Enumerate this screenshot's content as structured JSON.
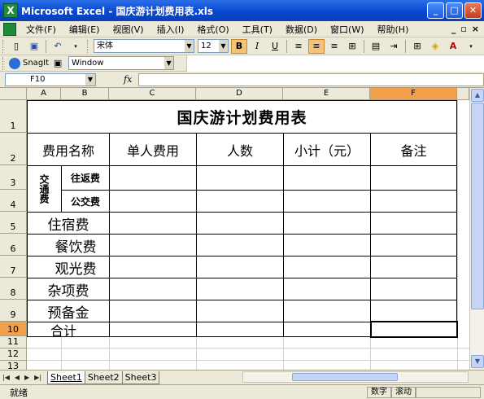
{
  "window": {
    "title": "Microsoft Excel - 国庆游计划费用表.xls",
    "app_icon": "X"
  },
  "menu": {
    "items": [
      "文件(F)",
      "编辑(E)",
      "视图(V)",
      "插入(I)",
      "格式(O)",
      "工具(T)",
      "数据(D)",
      "窗口(W)",
      "帮助(H)"
    ]
  },
  "toolbar": {
    "font_name": "宋体",
    "font_size": "12",
    "bold": "B",
    "italic": "I",
    "underline": "U"
  },
  "snagit": {
    "label": "SnagIt",
    "capture_mode": "Window"
  },
  "formula_bar": {
    "cell_ref": "F10",
    "fx": "fx",
    "value": ""
  },
  "columns": [
    "A",
    "B",
    "C",
    "D",
    "E",
    "F"
  ],
  "rows": [
    "1",
    "2",
    "3",
    "4",
    "5",
    "6",
    "7",
    "8",
    "9",
    "10",
    "11",
    "12",
    "13"
  ],
  "sheet": {
    "title": "国庆游计划费用表",
    "headers": {
      "name": "费用名称",
      "unit_cost": "单人费用",
      "people": "人数",
      "subtotal": "小计（元）",
      "note": "备注"
    },
    "transport_group": "交通费",
    "transport_items": [
      "往返费",
      "公交费"
    ],
    "items": [
      "住宿费",
      "餐饮费",
      "观光费",
      "杂项费",
      "预备金"
    ],
    "total": "合计"
  },
  "tabs": [
    "Sheet1",
    "Sheet2",
    "Sheet3"
  ],
  "status": {
    "ready": "就绪",
    "num": "数字",
    "scroll": "滚动"
  }
}
